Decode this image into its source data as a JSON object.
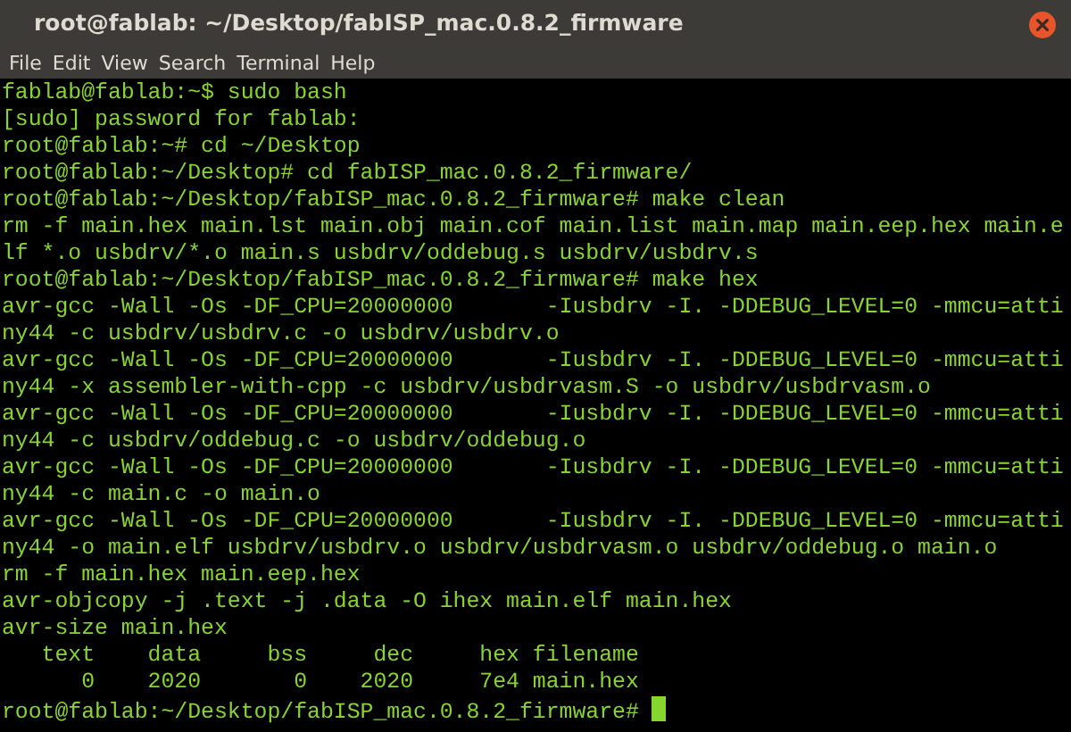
{
  "window": {
    "title": "root@fablab: ~/Desktop/fabISP_mac.0.8.2_firmware"
  },
  "menu": [
    "File",
    "Edit",
    "View",
    "Search",
    "Terminal",
    "Help"
  ],
  "terminal": {
    "lines": [
      "fablab@fablab:~$ sudo bash",
      "[sudo] password for fablab:",
      "root@fablab:~# cd ~/Desktop",
      "root@fablab:~/Desktop# cd fabISP_mac.0.8.2_firmware/",
      "root@fablab:~/Desktop/fabISP_mac.0.8.2_firmware# make clean",
      "rm -f main.hex main.lst main.obj main.cof main.list main.map main.eep.hex main.e",
      "lf *.o usbdrv/*.o main.s usbdrv/oddebug.s usbdrv/usbdrv.s",
      "root@fablab:~/Desktop/fabISP_mac.0.8.2_firmware# make hex",
      "avr-gcc -Wall -Os -DF_CPU=20000000       -Iusbdrv -I. -DDEBUG_LEVEL=0 -mmcu=atti",
      "ny44 -c usbdrv/usbdrv.c -o usbdrv/usbdrv.o",
      "avr-gcc -Wall -Os -DF_CPU=20000000       -Iusbdrv -I. -DDEBUG_LEVEL=0 -mmcu=atti",
      "ny44 -x assembler-with-cpp -c usbdrv/usbdrvasm.S -o usbdrv/usbdrvasm.o",
      "avr-gcc -Wall -Os -DF_CPU=20000000       -Iusbdrv -I. -DDEBUG_LEVEL=0 -mmcu=atti",
      "ny44 -c usbdrv/oddebug.c -o usbdrv/oddebug.o",
      "avr-gcc -Wall -Os -DF_CPU=20000000       -Iusbdrv -I. -DDEBUG_LEVEL=0 -mmcu=atti",
      "ny44 -c main.c -o main.o",
      "avr-gcc -Wall -Os -DF_CPU=20000000       -Iusbdrv -I. -DDEBUG_LEVEL=0 -mmcu=atti",
      "ny44 -o main.elf usbdrv/usbdrv.o usbdrv/usbdrvasm.o usbdrv/oddebug.o main.o",
      "rm -f main.hex main.eep.hex",
      "avr-objcopy -j .text -j .data -O ihex main.elf main.hex",
      "avr-size main.hex",
      "   text    data     bss     dec     hex filename",
      "      0    2020       0    2020     7e4 main.hex",
      "root@fablab:~/Desktop/fabISP_mac.0.8.2_firmware#"
    ]
  }
}
